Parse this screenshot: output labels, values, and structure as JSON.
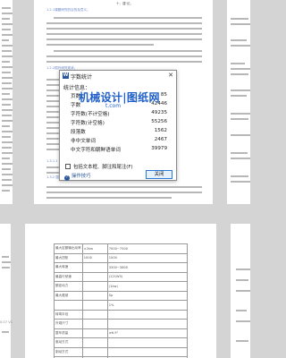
{
  "dialog": {
    "title": "字数统计",
    "app_icon_letter": "W",
    "close_glyph": "✕",
    "header": "统计信息：",
    "stats": [
      {
        "label": "页数",
        "value": "85"
      },
      {
        "label": "字数",
        "value": "42446"
      },
      {
        "label": "字符数(不计空格)",
        "value": "49235"
      },
      {
        "label": "字符数(计空格)",
        "value": "55256"
      },
      {
        "label": "段落数",
        "value": "1562"
      },
      {
        "label": "非中文单词",
        "value": "2467"
      },
      {
        "label": "中文字符和朝鲜语单词",
        "value": "39979"
      }
    ],
    "checkbox_label": "包括文本框、脚注和尾注(F)",
    "checkbox_checked": false,
    "help_icon_glyph": "?",
    "help_link": "操作技巧",
    "close_button": "关闭"
  },
  "watermark": {
    "main": "机械设计|图纸网",
    "sub": "t.com"
  },
  "doc": {
    "heading_top": "十、建·论。",
    "section_1_2": "1.2.1课题研究的目的及意义。",
    "section_1_2_2": "1.2.2国外研究现状，",
    "section_1_3": "1.3.1.1 国内研究现状。",
    "section_1_3_2": "1.3.2 国内研究现状。",
    "left_margin_mark": "0.07 VC"
  },
  "spec_table": [
    [
      "最大定额输出动率",
      "×2kw",
      "7000~7500"
    ],
    [
      "最大扭矩",
      "1000",
      "1000"
    ],
    [
      "最大转速",
      "",
      "3300~3800"
    ],
    [
      "最高行驶速",
      "",
      "(121W5)"
    ],
    [
      "额定动力",
      "",
      "(1kw)"
    ],
    [
      "最大爬坡",
      "",
      "Sp"
    ],
    [
      "",
      "",
      "1%"
    ],
    [
      "转弯半径",
      "",
      ""
    ],
    [
      "外观尺寸",
      "",
      ""
    ],
    [
      "整车质量",
      "",
      "≥6.9°"
    ],
    [
      "驱动方式",
      "",
      ""
    ],
    [
      "制动方式",
      "",
      ""
    ],
    [
      "传动方式",
      "",
      ""
    ]
  ]
}
